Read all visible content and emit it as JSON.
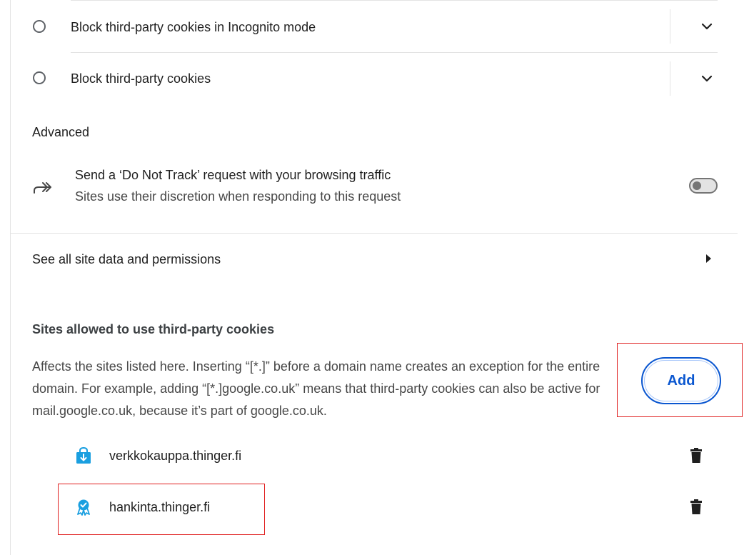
{
  "cookie_options": [
    {
      "label": "Block third-party cookies in Incognito mode"
    },
    {
      "label": "Block third-party cookies"
    }
  ],
  "advanced": {
    "heading": "Advanced",
    "do_not_track": {
      "title": "Send a ‘Do Not Track’ request with your browsing traffic",
      "subtitle": "Sites use their discretion when responding to this request",
      "enabled": false
    }
  },
  "see_all": {
    "label": "See all site data and permissions"
  },
  "allowed_sites": {
    "heading": "Sites allowed to use third-party cookies",
    "description": "Affects the sites listed here. Inserting “[*.]” before a domain name creates an exception for the entire domain. For example, adding “[*.]google.co.uk” means that third-party cookies can also be active for mail.google.co.uk, because it’s part of google.co.uk.",
    "add_label": "Add",
    "sites": [
      {
        "name": "verkkokauppa.thinger.fi",
        "icon": "download-bag-icon"
      },
      {
        "name": "hankinta.thinger.fi",
        "icon": "award-badge-icon"
      }
    ]
  },
  "colors": {
    "accent": "#0b57d0",
    "highlight": "#e02020",
    "site_icon": "#1a9fe0"
  }
}
